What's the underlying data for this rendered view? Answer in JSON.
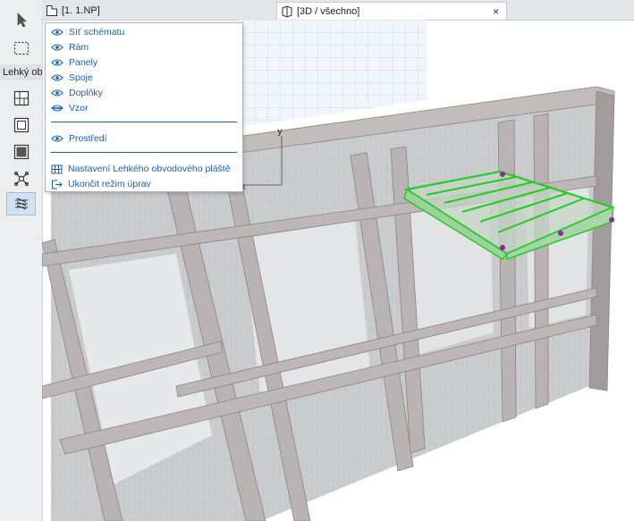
{
  "toolbox": {
    "label": "Lehký obvodový plášť",
    "tools": [
      {
        "name": "arrow-tool",
        "icon": "arrow-pointer-icon"
      },
      {
        "name": "marquee-tool",
        "icon": "marquee-icon"
      },
      {
        "name": "scheme-grid-tool",
        "icon": "scheme-grid-icon"
      },
      {
        "name": "frame-tool",
        "icon": "frame-icon"
      },
      {
        "name": "panel-tool",
        "icon": "panel-icon"
      },
      {
        "name": "junction-tool",
        "icon": "junction-icon"
      },
      {
        "name": "accessory-tool",
        "icon": "accessory-icon",
        "active": true
      }
    ]
  },
  "tabs": {
    "plan": "[1. 1.NP]",
    "view3d": "[3D / všechno]",
    "close_glyph": "×"
  },
  "viewport": {
    "axis_x": "x",
    "axis_y": "y"
  },
  "menu": {
    "items": {
      "schema_grid": "Síť schématu",
      "frame": "Rám",
      "panels": "Panely",
      "junctions": "Spoje",
      "accessories": "Doplňky",
      "pattern": "Vzor",
      "environment": "Prostředí",
      "settings": "Nastavení Lehkého obvodového pláště",
      "exit": "Ukončit režim úprav"
    }
  },
  "colors": {
    "accent": "#1a5fb4",
    "selection": "#22cc22",
    "hotspot": "#9b1fa5",
    "frame": "#b9b3b3",
    "panel": "#c9cbcd"
  }
}
